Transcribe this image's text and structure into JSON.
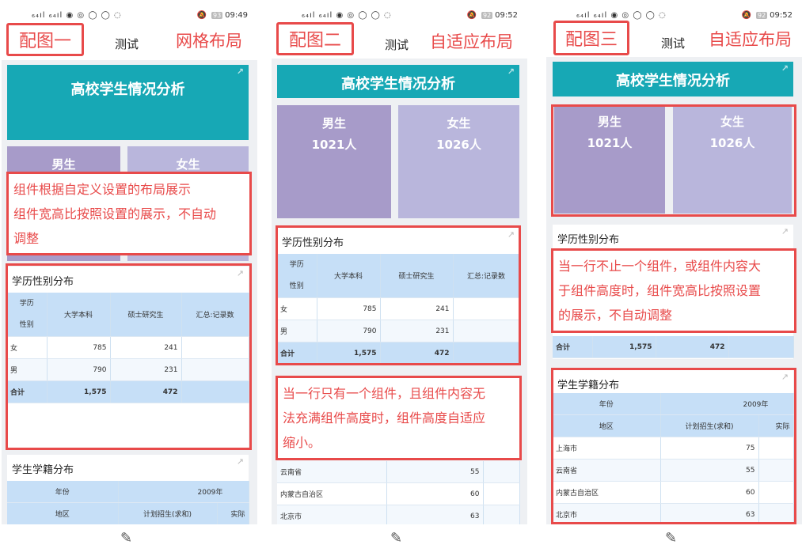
{
  "panels": [
    {
      "id": "panel1",
      "time": "09:49",
      "battery": "93",
      "tag": "配图一",
      "title": "测试",
      "layout_name": "网格布局",
      "banner": "高校学生情况分析",
      "male": {
        "label": "男生",
        "count": ""
      },
      "female": {
        "label": "女生",
        "count": ""
      },
      "annotation": [
        "组件根据自定义设置的布局展示",
        "组件宽高比按照设置的展示，不自动",
        "调整"
      ]
    },
    {
      "id": "panel2",
      "time": "09:52",
      "battery": "92",
      "tag": "配图二",
      "title": "测试",
      "layout_name": "自适应布局",
      "banner": "高校学生情况分析",
      "male": {
        "label": "男生",
        "count": "1021人"
      },
      "female": {
        "label": "女生",
        "count": "1026人"
      },
      "annotation": [
        "当一行只有一个组件，且组件内容无",
        "法充满组件高度时，组件高度自适应",
        "缩小。"
      ]
    },
    {
      "id": "panel3",
      "time": "09:52",
      "battery": "92",
      "tag": "配图三",
      "title": "测试",
      "layout_name": "自适应布局",
      "banner": "高校学生情况分析",
      "male": {
        "label": "男生",
        "count": "1021人"
      },
      "female": {
        "label": "女生",
        "count": "1026人"
      },
      "annotation": [
        "当一行不止一个组件，或组件内容大",
        "于组件高度时，组件宽高比按照设置",
        "的展示，不自动调整"
      ]
    }
  ],
  "edu_table": {
    "title": "学历性别分布",
    "header": [
      "学历性别",
      "大学本科",
      "硕士研究生",
      "汇总:记录数"
    ],
    "header_p2": [
      "学历性别",
      "大学本科",
      "硕士研究生",
      "汇总:记录数"
    ],
    "rows": [
      {
        "label": "女",
        "v1": "785",
        "v2": "241"
      },
      {
        "label": "男",
        "v1": "790",
        "v2": "231"
      }
    ],
    "total": {
      "label": "合计",
      "v1": "1,575",
      "v2": "472"
    }
  },
  "reg_table": {
    "title": "学生学籍分布",
    "year_label": "年份",
    "year": "2009年",
    "region_label": "地区",
    "col1": "计划招生(求和)",
    "col2": "实际",
    "rows": [
      {
        "label": "上海市",
        "v": "75"
      },
      {
        "label": "云南省",
        "v": "55"
      },
      {
        "label": "内蒙古自治区",
        "v": "60"
      },
      {
        "label": "北京市",
        "v": "63"
      }
    ]
  },
  "status_icons": "“”“”·•••"
}
